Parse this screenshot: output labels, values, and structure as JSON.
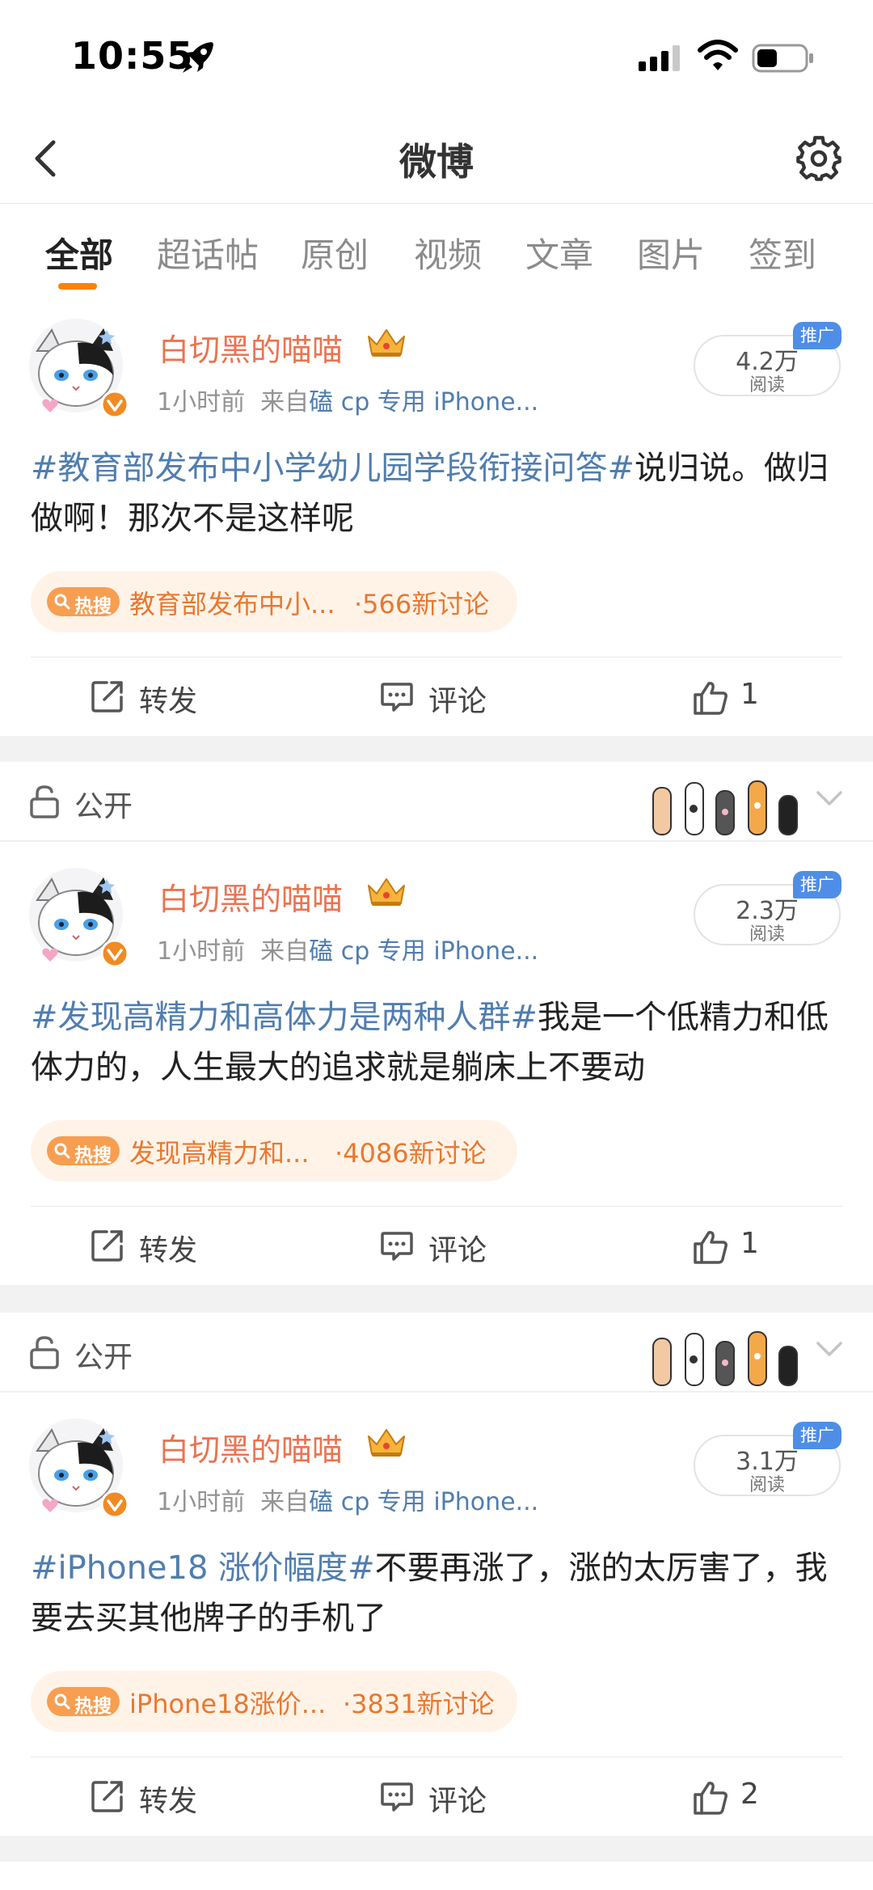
{
  "status_bar": {
    "time": "10:55"
  },
  "nav": {
    "title": "微博"
  },
  "tabs": [
    {
      "label": "全部"
    },
    {
      "label": "超话帖"
    },
    {
      "label": "原创"
    },
    {
      "label": "视频"
    },
    {
      "label": "文章"
    },
    {
      "label": "图片"
    },
    {
      "label": "签到"
    }
  ],
  "visibility_label": "公开",
  "posts": [
    {
      "username": "白切黑的喵喵",
      "time": "1小时前",
      "source_prefix": "来自",
      "source_device": "磕 cp 专用 iPhone...",
      "reads": "4.2万",
      "reads_label": "阅读",
      "promo": "推广",
      "topic": "#教育部发布中小学幼儿园学段衔接问答#",
      "body": "说归说。做归做啊！那次不是这样呢",
      "hot_badge": "热搜",
      "hot_title": "教育部发布中小...",
      "hot_count": "·566新讨论",
      "repost": "转发",
      "comment": "评论",
      "likes": "1"
    },
    {
      "username": "白切黑的喵喵",
      "time": "1小时前",
      "source_prefix": "来自",
      "source_device": "磕 cp 专用 iPhone...",
      "reads": "2.3万",
      "reads_label": "阅读",
      "promo": "推广",
      "topic": "#发现高精力和高体力是两种人群#",
      "body": "我是一个低精力和低体力的，人生最大的追求就是躺床上不要动",
      "hot_badge": "热搜",
      "hot_title": "发现高精力和...",
      "hot_count": "·4086新讨论",
      "repost": "转发",
      "comment": "评论",
      "likes": "1"
    },
    {
      "username": "白切黑的喵喵",
      "time": "1小时前",
      "source_prefix": "来自",
      "source_device": "磕 cp 专用 iPhone...",
      "reads": "3.1万",
      "reads_label": "阅读",
      "promo": "推广",
      "topic": "#iPhone18 涨价幅度#",
      "body": "不要再涨了，涨的太厉害了，我要去买其他牌子的手机了",
      "hot_badge": "热搜",
      "hot_title": "iPhone18涨价...",
      "hot_count": "·3831新讨论",
      "repost": "转发",
      "comment": "评论",
      "likes": "2"
    }
  ],
  "colors": {
    "accent": "#ff8200",
    "username": "#eb7350",
    "link": "#507daf",
    "hot_text": "#e8782f",
    "promo_badge": "#4e8ee6"
  }
}
